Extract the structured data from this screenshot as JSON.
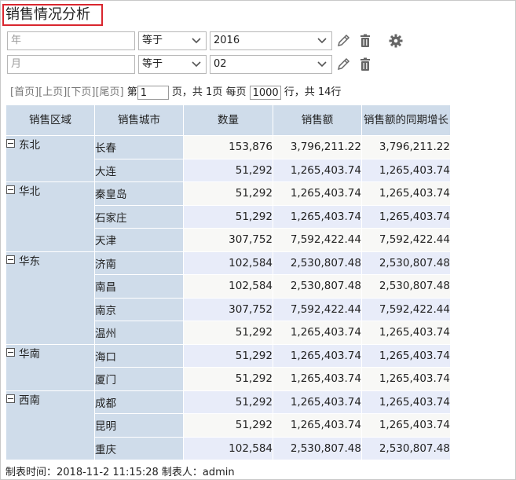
{
  "title": "销售情况分析",
  "filters": [
    {
      "field_placeholder": "年",
      "operator": "等于",
      "value": "2016"
    },
    {
      "field_placeholder": "月",
      "operator": "等于",
      "value": "02"
    }
  ],
  "icons": {
    "edit": "pencil-icon",
    "delete": "trash-icon",
    "settings": "gear-icon"
  },
  "pager": {
    "first": "[首页]",
    "prev": "[上页]",
    "next": "[下页]",
    "last": "[尾页]",
    "page_prefix": "第",
    "page_value": "1",
    "page_suffix": "页，共 1页 每页",
    "rows_value": "1000",
    "rows_suffix": "行，共 14行"
  },
  "table": {
    "headers": [
      "销售区域",
      "销售城市",
      "数量",
      "销售额",
      "销售额的同期增长"
    ],
    "groups": [
      {
        "region": "东北",
        "rows": [
          {
            "city": "长春",
            "qty": "153,876",
            "sales": "3,796,211.22",
            "growth": "3,796,211.22"
          },
          {
            "city": "大连",
            "qty": "51,292",
            "sales": "1,265,403.74",
            "growth": "1,265,403.74"
          }
        ]
      },
      {
        "region": "华北",
        "rows": [
          {
            "city": "秦皇岛",
            "qty": "51,292",
            "sales": "1,265,403.74",
            "growth": "1,265,403.74"
          },
          {
            "city": "石家庄",
            "qty": "51,292",
            "sales": "1,265,403.74",
            "growth": "1,265,403.74"
          },
          {
            "city": "天津",
            "qty": "307,752",
            "sales": "7,592,422.44",
            "growth": "7,592,422.44"
          }
        ]
      },
      {
        "region": "华东",
        "rows": [
          {
            "city": "济南",
            "qty": "102,584",
            "sales": "2,530,807.48",
            "growth": "2,530,807.48"
          },
          {
            "city": "南昌",
            "qty": "102,584",
            "sales": "2,530,807.48",
            "growth": "2,530,807.48"
          },
          {
            "city": "南京",
            "qty": "307,752",
            "sales": "7,592,422.44",
            "growth": "7,592,422.44"
          },
          {
            "city": "温州",
            "qty": "51,292",
            "sales": "1,265,403.74",
            "growth": "1,265,403.74"
          }
        ]
      },
      {
        "region": "华南",
        "rows": [
          {
            "city": "海口",
            "qty": "51,292",
            "sales": "1,265,403.74",
            "growth": "1,265,403.74"
          },
          {
            "city": "厦门",
            "qty": "51,292",
            "sales": "1,265,403.74",
            "growth": "1,265,403.74"
          }
        ]
      },
      {
        "region": "西南",
        "rows": [
          {
            "city": "成都",
            "qty": "51,292",
            "sales": "1,265,403.74",
            "growth": "1,265,403.74"
          },
          {
            "city": "昆明",
            "qty": "51,292",
            "sales": "1,265,403.74",
            "growth": "1,265,403.74"
          },
          {
            "city": "重庆",
            "qty": "102,584",
            "sales": "2,530,807.48",
            "growth": "2,530,807.48"
          }
        ]
      }
    ]
  },
  "footer": "制表时间：2018-11-2 11:15:28 制表人：admin"
}
